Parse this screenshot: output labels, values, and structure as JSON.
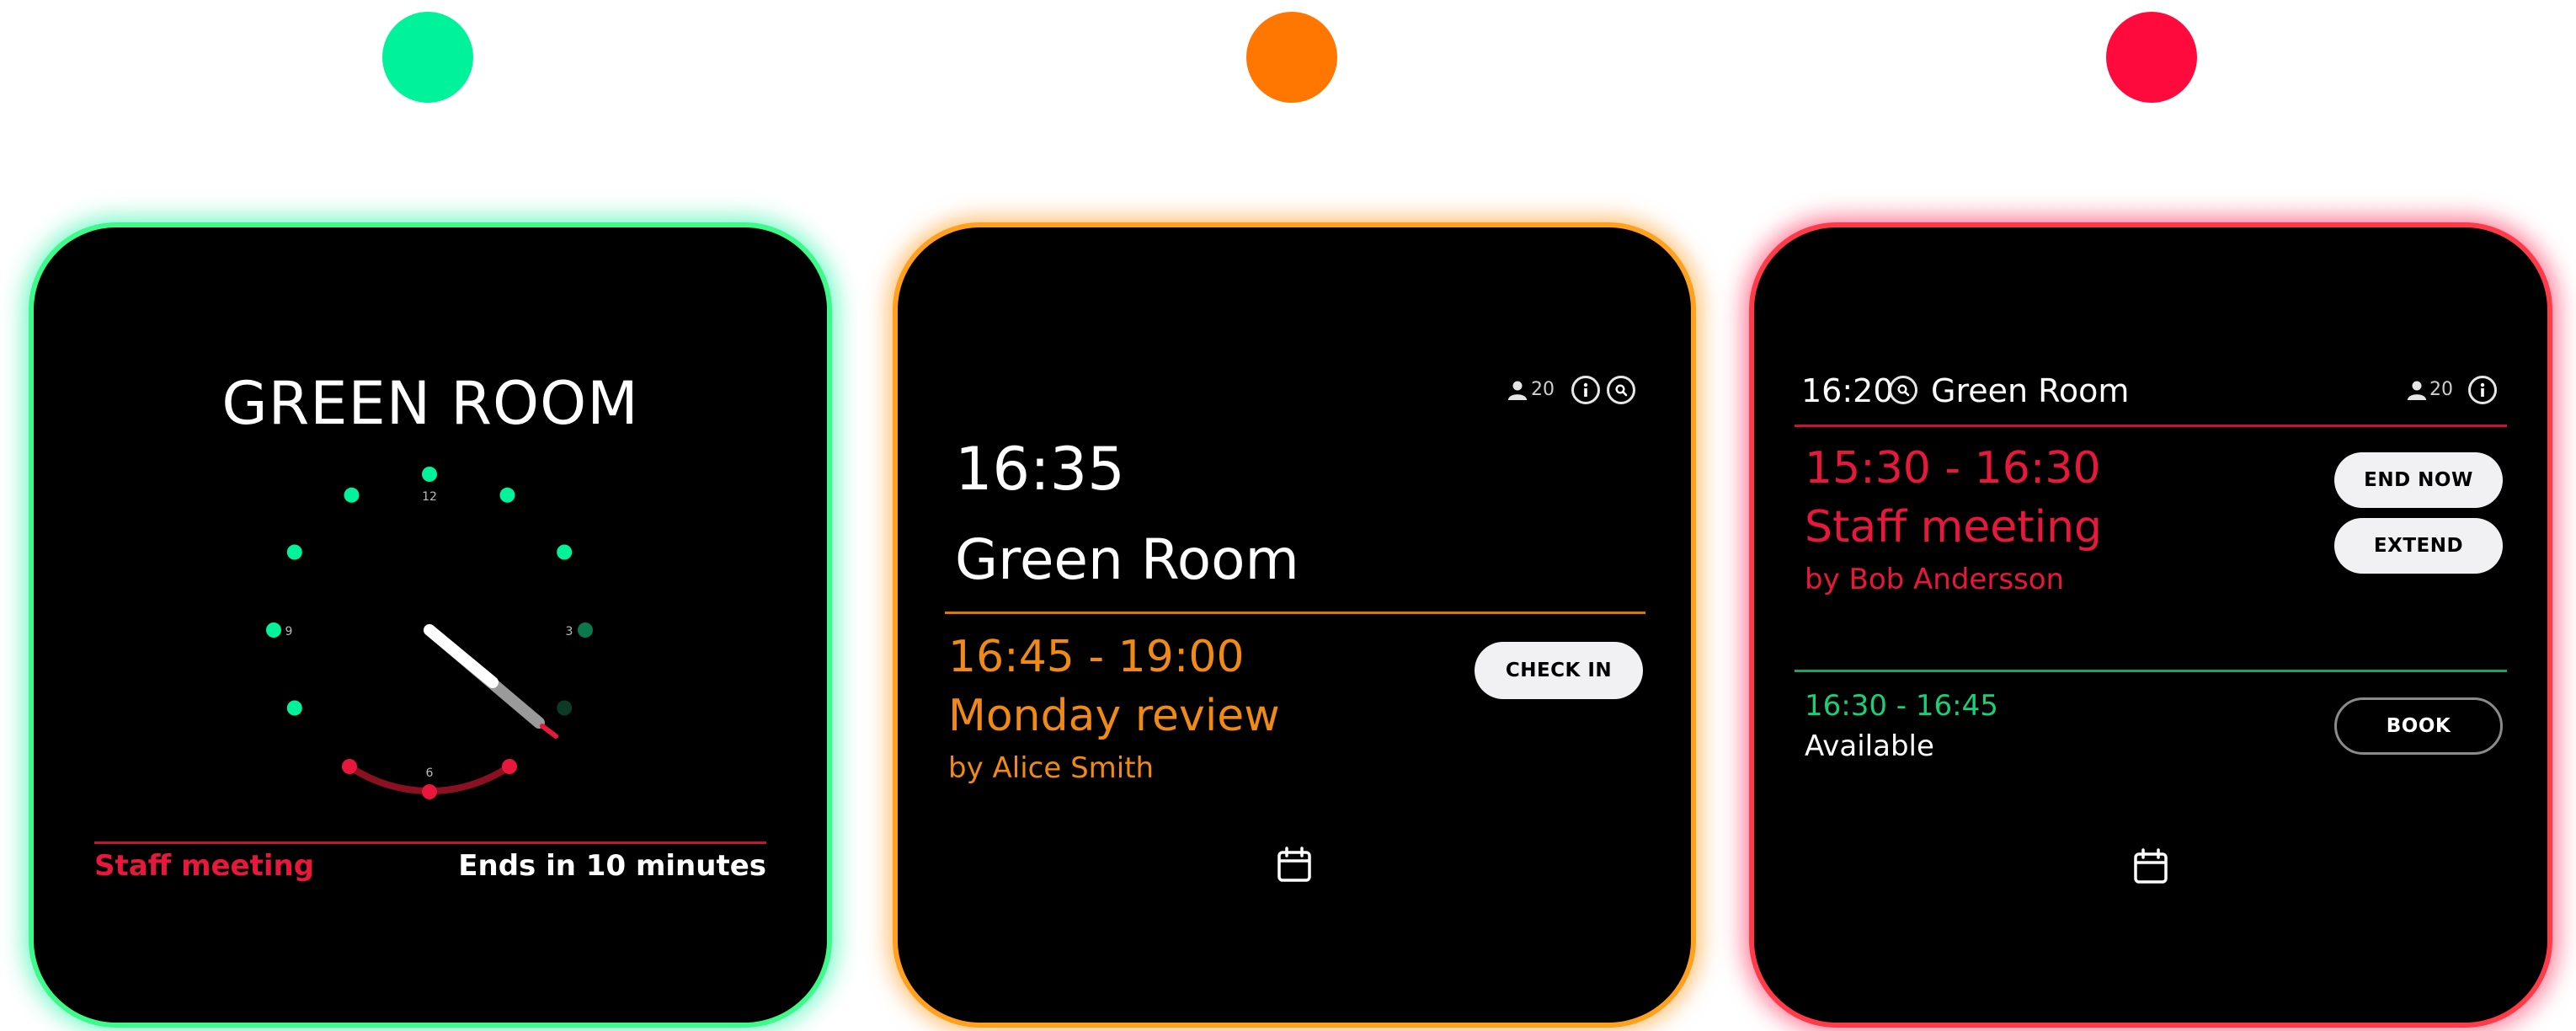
{
  "colors": {
    "green": "#00f29a",
    "orange": "#ff7700",
    "red": "#ff0a3c",
    "event_red": "#e8173c",
    "event_orange": "#f08a14",
    "available_green": "#19d07a"
  },
  "indicators": [
    {
      "name": "available",
      "color": "#00f29a"
    },
    {
      "name": "pending",
      "color": "#ff7700"
    },
    {
      "name": "occupied",
      "color": "#ff0a3c"
    }
  ],
  "panel_clock": {
    "room_name": "GREEN ROOM",
    "clock": {
      "labels": {
        "twelve": "12",
        "three": "3",
        "six": "6",
        "nine": "9"
      },
      "hour_deg": -55,
      "minute_deg": 125
    },
    "footer": {
      "event": "Staff meeting",
      "ends": "Ends in 10 minutes"
    }
  },
  "panel_checkin": {
    "capacity": "20",
    "icons": {
      "person": "person-icon",
      "info": "info-icon",
      "search": "search-icon",
      "calendar": "calendar-icon"
    },
    "time": "16:35",
    "room_name": "Green Room",
    "event": {
      "time_range": "16:45 - 19:00",
      "title": "Monday review",
      "organizer": "by Alice Smith"
    },
    "check_in_label": "CHECK IN"
  },
  "panel_occupied": {
    "time": "16:20",
    "room_name": "Green Room",
    "capacity": "20",
    "icons": {
      "search": "search-icon",
      "person": "person-icon",
      "info": "info-icon",
      "calendar": "calendar-icon"
    },
    "current_event": {
      "time_range": "15:30 - 16:30",
      "title": "Staff meeting",
      "organizer": "by Bob Andersson"
    },
    "end_now_label": "END NOW",
    "extend_label": "EXTEND",
    "next_slot": {
      "time_range": "16:30 - 16:45",
      "status": "Available"
    },
    "book_label": "BOOK"
  }
}
